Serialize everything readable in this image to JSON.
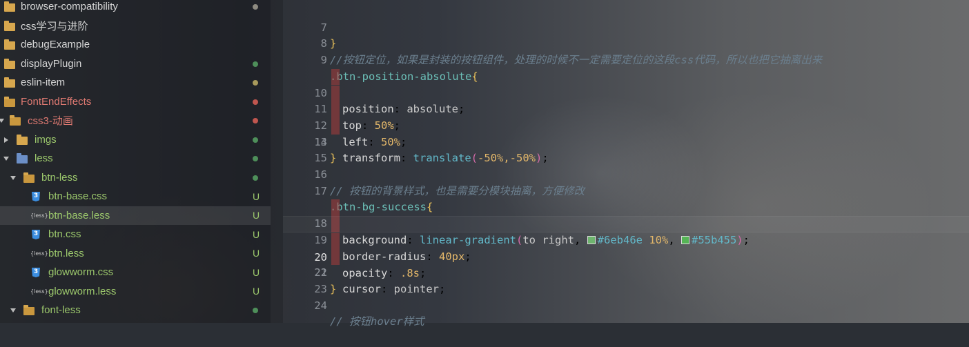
{
  "sidebar": {
    "items": [
      {
        "label": "browser-compatibility",
        "type": "folder",
        "status": ""
      },
      {
        "label": "css学习与进阶",
        "type": "folder",
        "status": ""
      },
      {
        "label": "debugExample",
        "type": "folder",
        "status": ""
      },
      {
        "label": "displayPlugin",
        "type": "folder",
        "status": ""
      },
      {
        "label": "eslin-item",
        "type": "folder",
        "status": ""
      },
      {
        "label": "FontEndEffects",
        "type": "folder-open",
        "status": ""
      },
      {
        "label": "css3-动画",
        "type": "folder-open",
        "status": ""
      },
      {
        "label": "imgs",
        "type": "folder",
        "status": ""
      },
      {
        "label": "less",
        "type": "less-folder",
        "status": ""
      },
      {
        "label": "btn-less",
        "type": "folder-open",
        "status": ""
      },
      {
        "label": "btn-base.css",
        "type": "css-file",
        "status": "U"
      },
      {
        "label": "btn-base.less",
        "type": "less-file",
        "status": "U"
      },
      {
        "label": "btn.css",
        "type": "css-file",
        "status": "U"
      },
      {
        "label": "btn.less",
        "type": "less-file",
        "status": "U"
      },
      {
        "label": "glowworm.css",
        "type": "css-file",
        "status": "U"
      },
      {
        "label": "glowworm.less",
        "type": "less-file",
        "status": "U"
      },
      {
        "label": "font-less",
        "type": "folder-open",
        "status": ""
      }
    ],
    "less_badge": "{less}",
    "css_badge": "3"
  },
  "editor": {
    "lines": [
      {
        "n": "7",
        "code": "}"
      },
      {
        "n": "8",
        "code": "//按钮定位，如果是封装的按钮组件，处理的时候不一定需要定位的这段css代码，所以也把它抽离出来"
      },
      {
        "n": "9",
        "code": ".btn-position-absolute{"
      },
      {
        "n": "10",
        "code": "position: absolute;"
      },
      {
        "n": "11",
        "code": "top: 50%;"
      },
      {
        "n": "12",
        "code": "left: 50%;"
      },
      {
        "n": "13",
        "code": "transform: translate(-50%,-50%);"
      },
      {
        "n": "14",
        "code": "}"
      },
      {
        "n": "15",
        "code": ""
      },
      {
        "n": "16",
        "code": "// 按钮的背景样式，也是需要分模块抽离，方便修改"
      },
      {
        "n": "17",
        "code": ".btn-bg-success{"
      },
      {
        "n": "18",
        "code": "background: linear-gradient(to right, #6eb46e 10%, #55b455);"
      },
      {
        "n": "19",
        "code": "border-radius: 40px;"
      },
      {
        "n": "20",
        "code": "opacity: .8s;"
      },
      {
        "n": "21",
        "code": "cursor: pointer;"
      },
      {
        "n": "22",
        "code": "}"
      },
      {
        "n": "23",
        "code": ""
      },
      {
        "n": "24",
        "code": "// 按钮hover样式"
      }
    ],
    "active_line": "20",
    "tokens": {
      "l9_sel": ".btn-position-absolute",
      "l10_prop": "position",
      "l10_val": "absolute",
      "l11_prop": "top",
      "l11_val": "50%",
      "l12_prop": "left",
      "l12_val": "50%",
      "l13_prop": "transform",
      "l13_fn": "translate",
      "l13_args": "-50%,-50%",
      "l17_sel": ".btn-bg-success",
      "l18_prop": "background",
      "l18_fn": "linear-gradient",
      "l18_dir": "to right",
      "l18_hex1": "#6eb46e",
      "l18_stop1": "10%",
      "l18_hex2": "#55b455",
      "l19_prop": "border-radius",
      "l19_val": "40px",
      "l20_prop": "opacity",
      "l20_val": ".8s",
      "l21_prop": "cursor",
      "l21_val": "pointer",
      "brace_open": "{",
      "brace_close": "}"
    }
  },
  "colors": {
    "swatch1": "#6eb46e",
    "swatch2": "#55b455",
    "status_green": "#9cc86c",
    "modified_red": "#e07a72"
  }
}
